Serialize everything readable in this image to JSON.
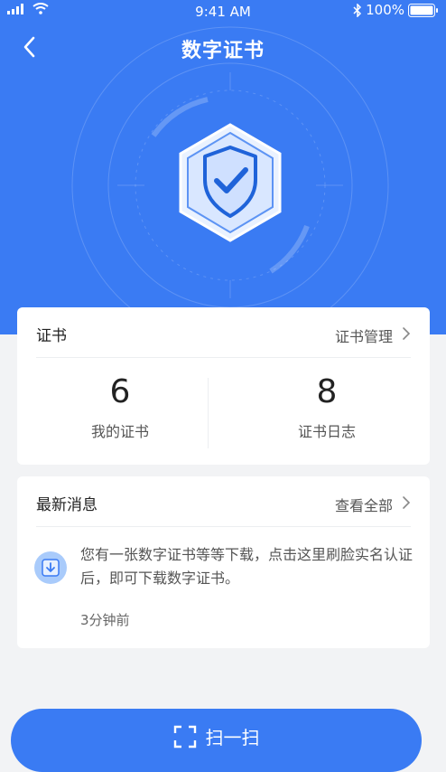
{
  "status_bar": {
    "time": "9:41 AM",
    "battery": "100%"
  },
  "header": {
    "title": "数字证书"
  },
  "certificates": {
    "title": "证书",
    "manage_label": "证书管理",
    "stats": [
      {
        "value": "6",
        "label": "我的证书"
      },
      {
        "value": "8",
        "label": "证书日志"
      }
    ]
  },
  "messages": {
    "title": "最新消息",
    "view_all_label": "查看全部",
    "latest": {
      "text": "您有一张数字证书等等下载，点击这里刷脸实名认证后，即可下载数字证书。",
      "time": "3分钟前"
    }
  },
  "scan_button": {
    "label": "扫一扫"
  },
  "colors": {
    "primary": "#3a7bf3",
    "background": "#f2f3f5"
  }
}
